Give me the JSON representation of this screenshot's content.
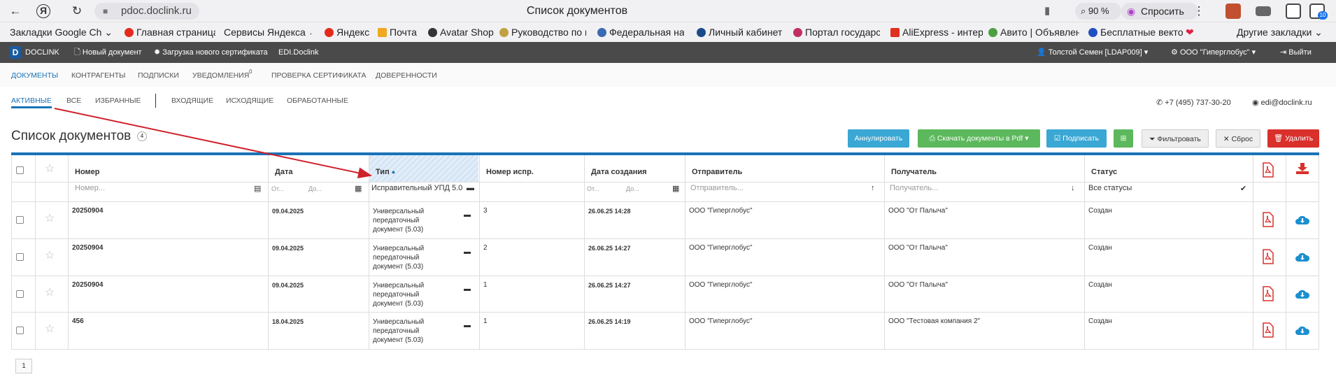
{
  "browser": {
    "url": "pdoc.doclink.ru",
    "tab_title": "Список документов",
    "zoom": "90 %",
    "ask_label": "Спросить",
    "ext_badge": "10"
  },
  "bookmarks": [
    {
      "label": "Закладки Google Ch",
      "color": "#ffffff"
    },
    {
      "label": "Главная страница",
      "color": "#e32b1c"
    },
    {
      "label": "Сервисы Яндекса",
      "color": "#ffffff"
    },
    {
      "label": "Яндекс",
      "color": "#e32b1c"
    },
    {
      "label": "Почта",
      "color": "#f0a820"
    },
    {
      "label": "Avatar Shop",
      "color": "#333333"
    },
    {
      "label": "Руководство по п",
      "color": "#c0a040"
    },
    {
      "label": "Федеральная нал",
      "color": "#3a6ab0"
    },
    {
      "label": "Личный кабинет",
      "color": "#1a4a8a"
    },
    {
      "label": "Портал государс",
      "color": "#c03060"
    },
    {
      "label": "AliExpress - интер",
      "color": "#e03020"
    },
    {
      "label": "Авито | Объявлен",
      "color": "#4aa040"
    },
    {
      "label": "Бесплатные векто",
      "color": "#2050c0"
    },
    {
      "label": "Другие закладки",
      "color": "#ffffff"
    }
  ],
  "appbar": {
    "logo_letter": "D",
    "brand": "DOCLINK",
    "new_doc": "Новый документ",
    "upload_cert": "Загрузка нового сертификата",
    "edi": "EDI.Doclink",
    "user": "Толстой Семен [LDAP009]",
    "org": "ООО \"Гиперглобус\"",
    "logout": "Выйти"
  },
  "nav": {
    "items": [
      "ДОКУМЕНТЫ",
      "КОНТРАГЕНТЫ",
      "ПОДПИСКИ",
      "УВЕДОМЛЕНИЯ",
      "ПРОВЕРКА СЕРТИФИКАТА",
      "ДОВЕРЕННОСТИ"
    ],
    "notif_count": "0"
  },
  "subnav": {
    "items": [
      "АКТИВНЫЕ",
      "ВСЕ",
      "ИЗБРАННЫЕ",
      "ВХОДЯЩИЕ",
      "ИСХОДЯЩИЕ",
      "ОБРАБОТАННЫЕ"
    ],
    "phone": "+7 (495) 737-30-20",
    "email": "edi@doclink.ru"
  },
  "page": {
    "title": "Список документов",
    "count": "4"
  },
  "toolbar": {
    "annul": "Аннулировать",
    "download_pdf": "Скачать документы в Pdf",
    "sign": "Подписать",
    "filter": "Фильтровать",
    "reset": "Сброс",
    "delete": "Удалить"
  },
  "colors": {
    "accent": "#1a73b8",
    "annul": "#3aa7d4",
    "download": "#5cb85c",
    "sign": "#3aa7d4",
    "delete": "#d9302c",
    "arrow": "#d0202a"
  },
  "table": {
    "headers": {
      "number": "Номер",
      "date": "Дата",
      "type": "Тип",
      "corr_number": "Номер испр.",
      "created": "Дата создания",
      "sender": "Отправитель",
      "receiver": "Получатель",
      "status": "Статус"
    },
    "filters": {
      "number_ph": "Номер...",
      "date_from": "От...",
      "date_to": "До...",
      "type_value": "Исправительный УПД 5.0",
      "created_from": "От...",
      "created_to": "До...",
      "sender_ph": "Отправитель...",
      "receiver_ph": "Получатель...",
      "status_value": "Все статусы"
    },
    "rows": [
      {
        "number": "20250904",
        "date": "09.04.2025",
        "type": [
          "Универсальный",
          "передаточный",
          "документ (5.03)"
        ],
        "corr": "3",
        "created": "26.06.25 14:28",
        "sender": "ООО \"Гиперглобус\"",
        "receiver": "ООО \"От Палыча\"",
        "status": "Создан"
      },
      {
        "number": "20250904",
        "date": "09.04.2025",
        "type": [
          "Универсальный",
          "передаточный",
          "документ (5.03)"
        ],
        "corr": "2",
        "created": "26.06.25 14:27",
        "sender": "ООО \"Гиперглобус\"",
        "receiver": "ООО \"От Палыча\"",
        "status": "Создан"
      },
      {
        "number": "20250904",
        "date": "09.04.2025",
        "type": [
          "Универсальный",
          "передаточный",
          "документ (5.03)"
        ],
        "corr": "1",
        "created": "26.06.25 14:27",
        "sender": "ООО \"Гиперглобус\"",
        "receiver": "ООО \"От Палыча\"",
        "status": "Создан"
      },
      {
        "number": "456",
        "date": "18.04.2025",
        "type": [
          "Универсальный",
          "передаточный",
          "документ (5.03)"
        ],
        "corr": "1",
        "created": "26.06.25 14:19",
        "sender": "ООО \"Гиперглобус\"",
        "receiver": "ООО \"Тестовая компания 2\"",
        "status": "Создан"
      }
    ]
  },
  "pager": {
    "page": "1"
  }
}
